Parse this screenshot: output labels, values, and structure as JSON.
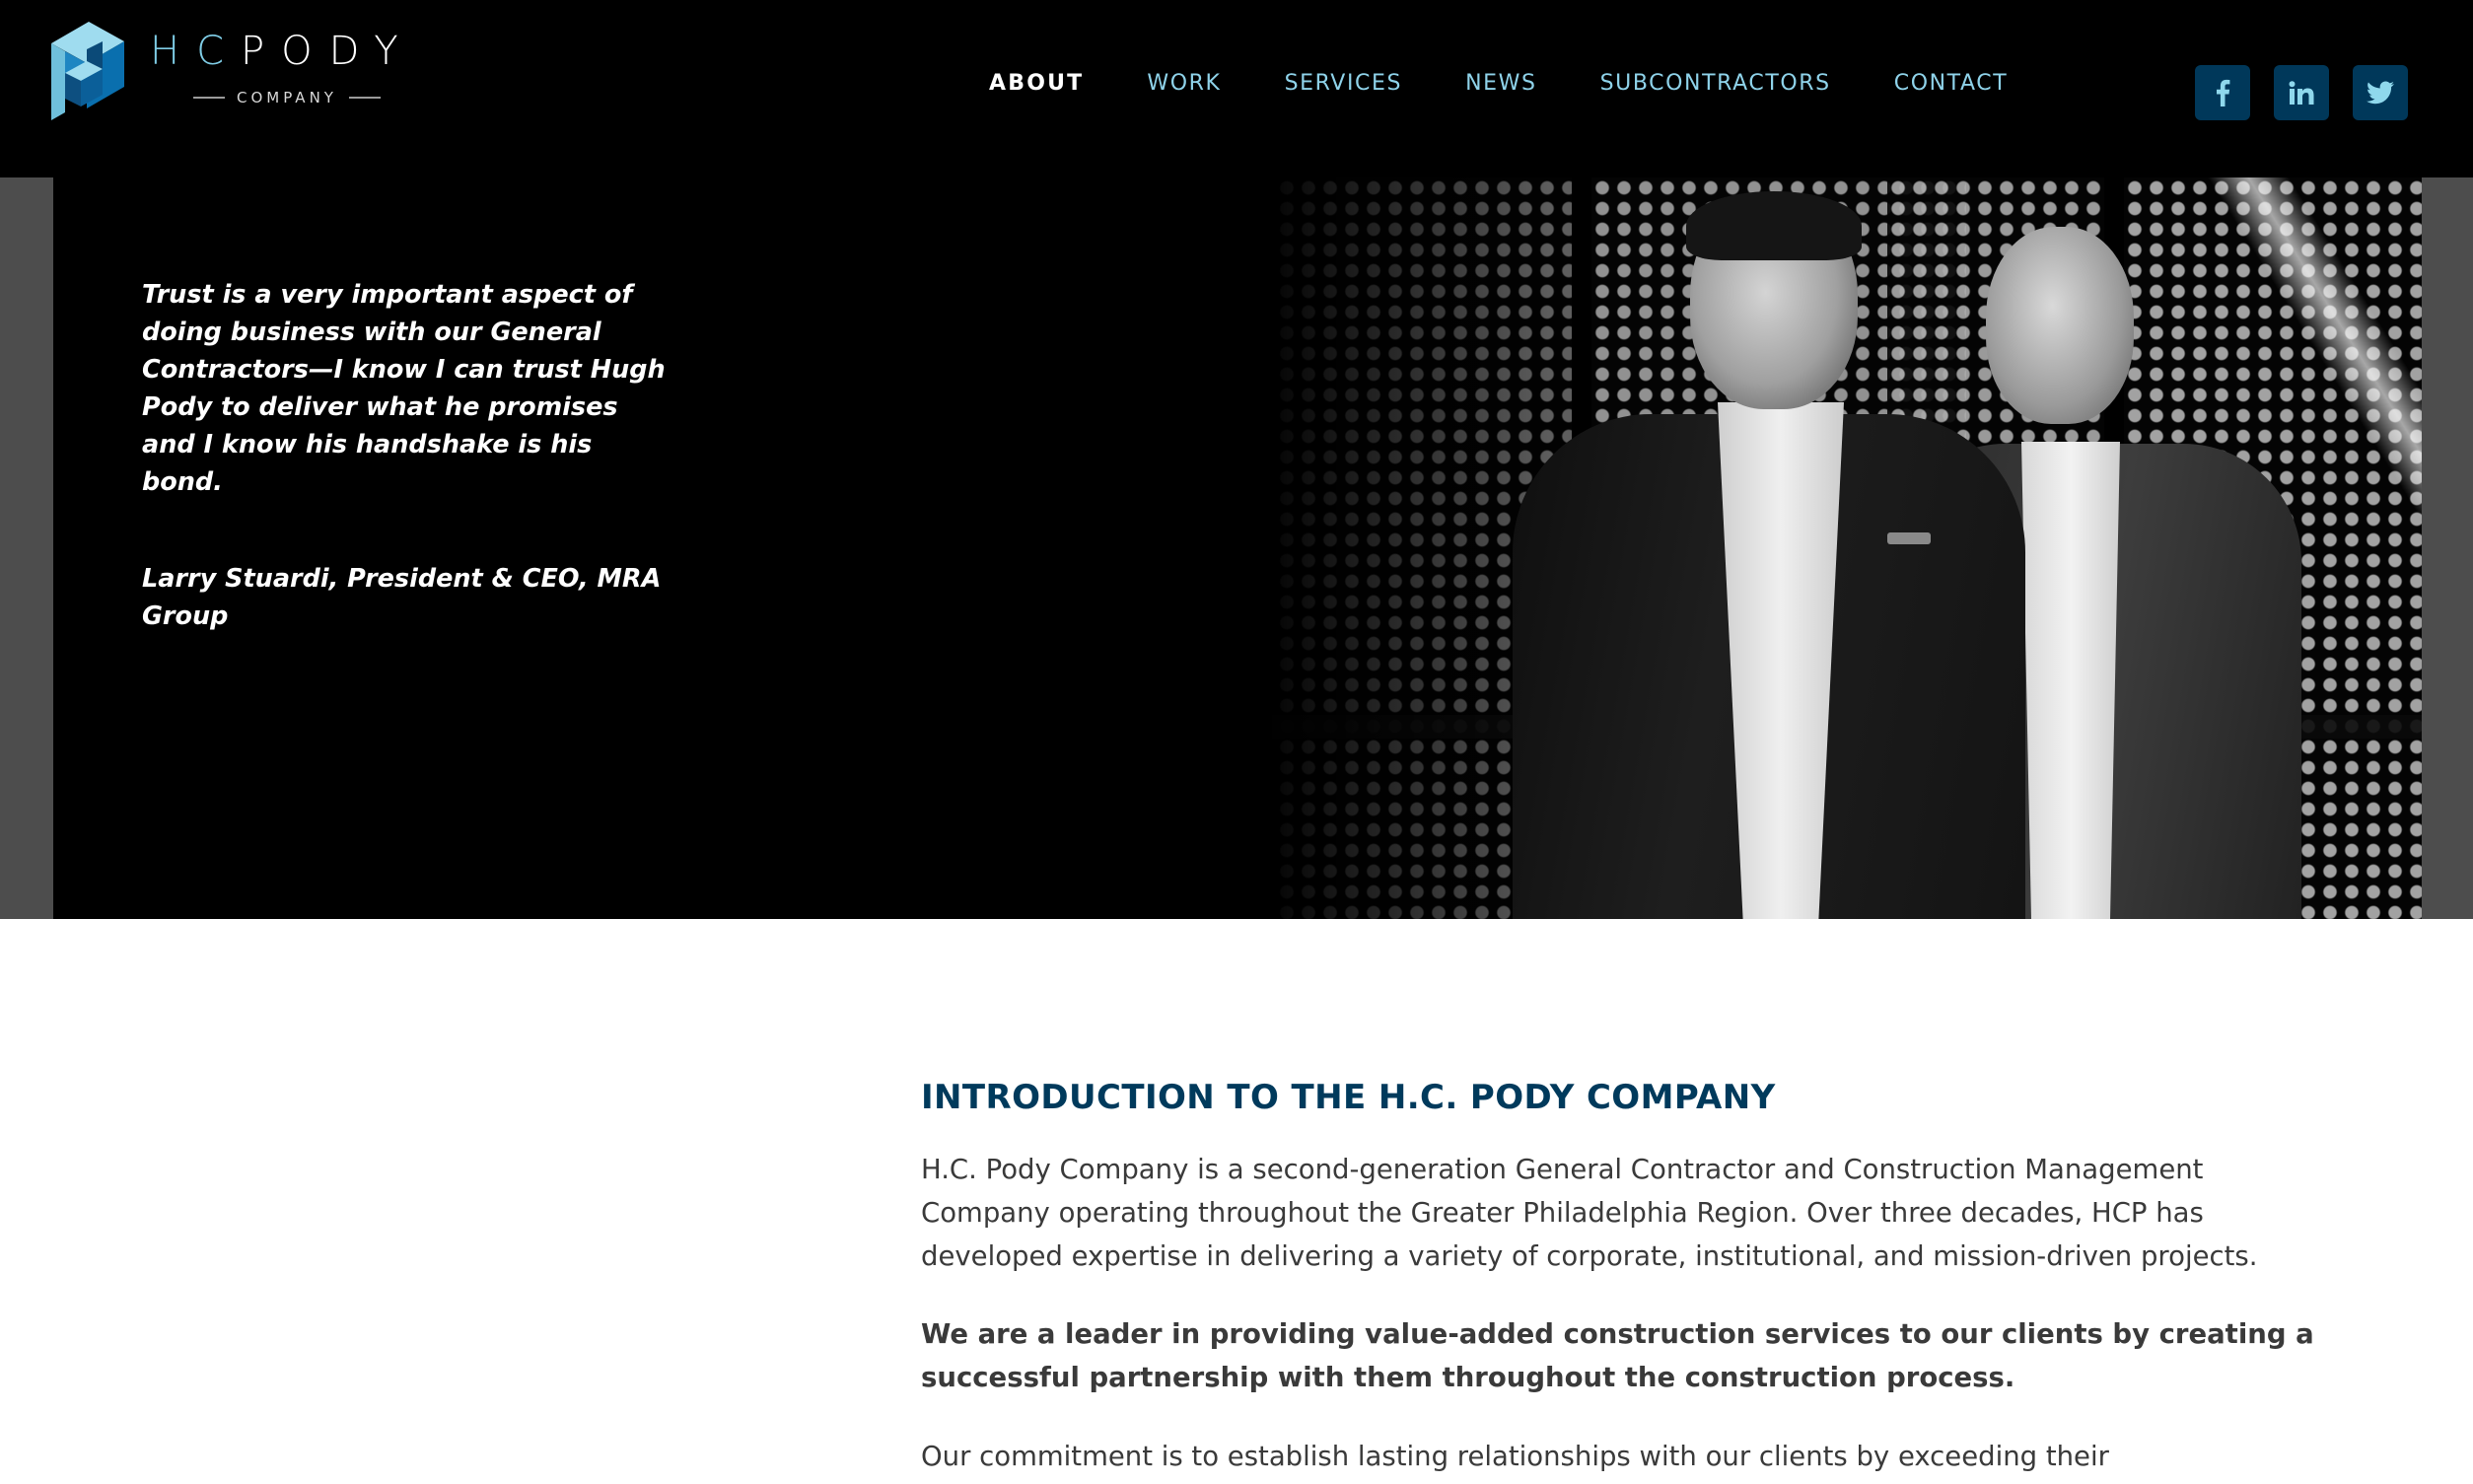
{
  "brand": {
    "logo_initials": "HC",
    "logo_name": "PODY",
    "logo_subtitle": "COMPANY",
    "colors": {
      "header_bg": "#000000",
      "nav_link": "#8fd3ea",
      "nav_active": "#ffffff",
      "social_bg": "#00385a",
      "heading": "#003a5c",
      "body_text": "#3a3a3a",
      "hero_side": "#4d4d4d"
    }
  },
  "nav": {
    "items": [
      {
        "label": "ABOUT",
        "active": true
      },
      {
        "label": "WORK",
        "active": false
      },
      {
        "label": "SERVICES",
        "active": false
      },
      {
        "label": "NEWS",
        "active": false
      },
      {
        "label": "SUBCONTRACTORS",
        "active": false
      },
      {
        "label": "CONTACT",
        "active": false
      }
    ]
  },
  "social": [
    {
      "name": "facebook",
      "icon": "facebook-icon"
    },
    {
      "name": "linkedin",
      "icon": "linkedin-icon"
    },
    {
      "name": "twitter",
      "icon": "twitter-icon"
    }
  ],
  "hero": {
    "quote": "Trust is a very important aspect of doing business with our General Contractors—I know I can trust Hugh Pody to deliver what he promises and I know his handshake is his bond.",
    "attribution": "Larry Stuardi, President & CEO, MRA Group",
    "photo_alt": "Two executives in suits standing in front of perforated metal panels (black and white photo)"
  },
  "intro": {
    "heading": "INTRODUCTION TO THE H.C. PODY COMPANY",
    "paragraphs": [
      "H.C. Pody Company is a second-generation General Contractor and Construction Management Company operating throughout the Greater Philadelphia Region. Over three decades, HCP has developed expertise in delivering a variety of corporate, institutional, and mission-driven projects.",
      "We are a leader in providing value-added construction services to our clients by creating a successful partnership with them throughout the construction process.",
      "Our commitment is to establish lasting relationships with our clients by exceeding their"
    ]
  }
}
